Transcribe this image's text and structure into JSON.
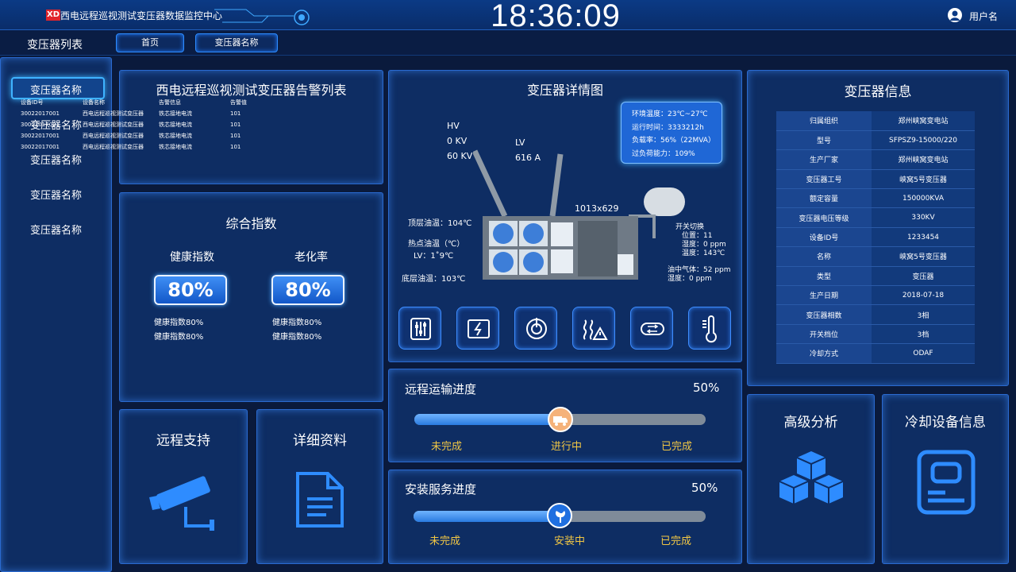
{
  "header": {
    "logo": "XD",
    "title": "西电远程巡视测试变压器数据监控中心",
    "clock": "18:36:09",
    "user": "用户名"
  },
  "nav": {
    "title": "变压器列表",
    "tabs": [
      "首页",
      "变压器名称"
    ]
  },
  "sidebar": {
    "items": [
      "变压器名称",
      "变压器名称",
      "变压器名称",
      "变压器名称",
      "变压器名称"
    ]
  },
  "alarm": {
    "title": "西电远程巡视测试变压器告警列表",
    "headers": [
      "设备ID号",
      "设备名称",
      "告警信息",
      "告警值"
    ],
    "rows": [
      [
        "30022017001",
        "西电远程巡视测试变压器",
        "铁芯接地电流",
        "101"
      ],
      [
        "30022017001",
        "西电远程巡视测试变压器",
        "铁芯接地电流",
        "101"
      ],
      [
        "30022017001",
        "西电远程巡视测试变压器",
        "铁芯接地电流",
        "101"
      ],
      [
        "30022017001",
        "西电远程巡视测试变压器",
        "铁芯接地电流",
        "101"
      ]
    ]
  },
  "composite": {
    "title": "综合指数",
    "health": {
      "label": "健康指数",
      "value": "80%",
      "fraction": 0.8,
      "notes": [
        "健康指数80%",
        "健康指数80%"
      ]
    },
    "aging": {
      "label": "老化率",
      "value": "80%",
      "fraction": 0.8,
      "notes": [
        "健康指数80%",
        "健康指数80%"
      ]
    }
  },
  "remote_support": {
    "label": "远程支持",
    "icon": "camera-icon"
  },
  "details": {
    "label": "详细资料",
    "icon": "document-icon"
  },
  "detail_view": {
    "title": "变压器详情图",
    "env": [
      "环境温度：23℃~27℃",
      "运行时间：3333212h",
      "负载率：56%（22MVA）",
      "过负荷能力：109%"
    ],
    "hv": [
      "HV",
      "0 KV",
      "60 KV"
    ],
    "lv": [
      "LV",
      "616 A"
    ],
    "size": "1013x629",
    "left_labels": [
      "顶层油温：104℃",
      "热点油温（℃）",
      "LV：1˚9℃",
      "底层油温：103℃"
    ],
    "switch": [
      "开关切换",
      "位置：11",
      "湿度：0 ppm",
      "温度：143℃"
    ],
    "gas": [
      "油中气体：52 ppm",
      "湿度：0 ppm"
    ],
    "tools": [
      "sliders-icon",
      "battery-icon",
      "power-icon",
      "heat-warning-icon",
      "exchange-icon",
      "thermometer-icon"
    ]
  },
  "info": {
    "title": "变压器信息",
    "rows": [
      [
        "归属组织",
        "郑州峡窝变电站"
      ],
      [
        "型号",
        "SFPSZ9-15000/220"
      ],
      [
        "生产厂家",
        "郑州峡窝变电站"
      ],
      [
        "变压器工号",
        "峡窝5号变压器"
      ],
      [
        "额定容量",
        "150000KVA"
      ],
      [
        "变压器电压等级",
        "330KV"
      ],
      [
        "设备ID号",
        "1233454"
      ],
      [
        "名称",
        "峡窝5号变压器"
      ],
      [
        "类型",
        "变压器"
      ],
      [
        "生产日期",
        "2018-07-18"
      ],
      [
        "变压器相数",
        "3相"
      ],
      [
        "开关档位",
        "3档"
      ],
      [
        "冷却方式",
        "ODAF"
      ]
    ]
  },
  "transport": {
    "title": "远程运输进度",
    "percent": "50%",
    "fraction": 0.5,
    "stages": [
      "未完成",
      "进行中",
      "已完成"
    ]
  },
  "install": {
    "title": "安装服务进度",
    "percent": "50%",
    "fraction": 0.5,
    "stages": [
      "未完成",
      "安装中",
      "已完成"
    ]
  },
  "analysis": {
    "label": "高级分析",
    "icon": "cubes-icon"
  },
  "cooling": {
    "label": "冷却设备信息",
    "icon": "id-card-icon"
  },
  "colors": {
    "accent": "#2e8cff",
    "panel": "#0e2d63",
    "stage_text": "#f2c744"
  }
}
